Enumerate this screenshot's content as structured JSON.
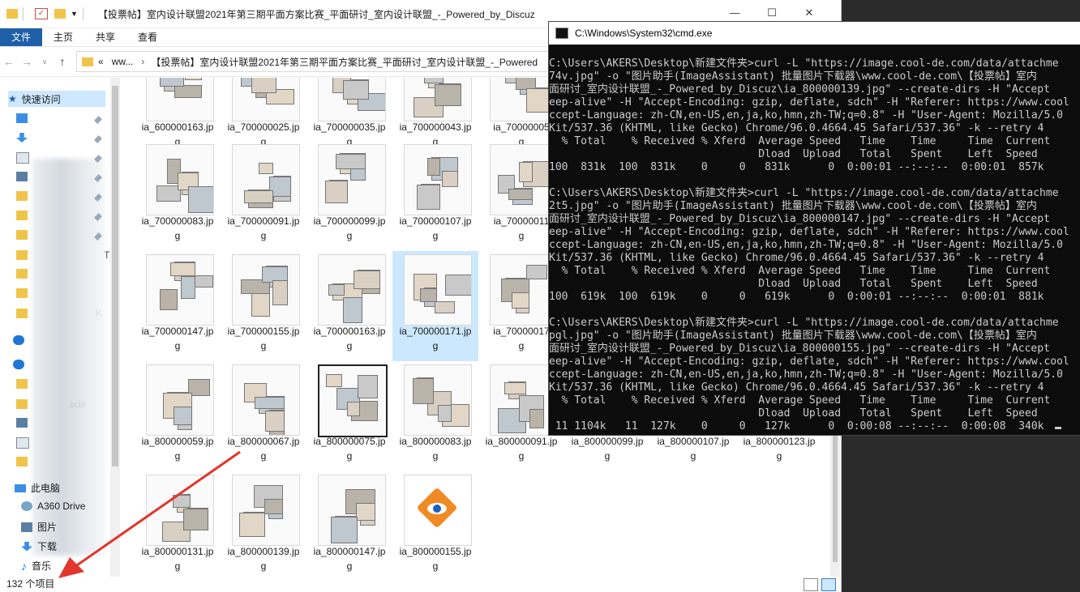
{
  "explorer": {
    "title": "【投票帖】室内设计联盟2021年第三期平面方案比赛_平面研讨_室内设计联盟_-_Powered_by_Discuz",
    "ribbon_tabs": [
      "文件",
      "主页",
      "共享",
      "查看"
    ],
    "address": {
      "prefix": "«",
      "crumb1": "ww...",
      "crumb2": "【投票帖】室内设计联盟2021年第三期平面方案比赛_平面研讨_室内设计联盟_-_Powered"
    },
    "nav": {
      "quick_access": "快速访问",
      "this_pc": "此电脑",
      "a360": "A360 Drive",
      "pictures": "图片",
      "downloads": "下载",
      "music": "音乐",
      "partial_downloads": "ads",
      "partial_t3": "T3",
      "partial_k": "K"
    },
    "files": [
      {
        "l1": "ia_600000163.jp",
        "l2": "g"
      },
      {
        "l1": "ia_700000025.jp",
        "l2": "g"
      },
      {
        "l1": "ia_700000035.jp",
        "l2": "g"
      },
      {
        "l1": "ia_700000043.jp",
        "l2": "g"
      },
      {
        "l1": "ia_70000005",
        "l2": "g"
      },
      {
        "l1": "ia_700000083.jp",
        "l2": "g"
      },
      {
        "l1": "ia_700000091.jp",
        "l2": "g"
      },
      {
        "l1": "ia_700000099.jp",
        "l2": "g"
      },
      {
        "l1": "ia_700000107.jp",
        "l2": "g"
      },
      {
        "l1": "ia_70000011",
        "l2": "g"
      },
      {
        "l1": "ia_700000147.jp",
        "l2": "g"
      },
      {
        "l1": "ia_700000155.jp",
        "l2": "g"
      },
      {
        "l1": "ia_700000163.jp",
        "l2": "g"
      },
      {
        "l1": "ia_700000171.jp",
        "l2": "g"
      },
      {
        "l1": "ia_70000017",
        "l2": "g"
      },
      {
        "l1": "ia_800000059.jp",
        "l2": "g"
      },
      {
        "l1": "ia_800000067.jp",
        "l2": "g"
      },
      {
        "l1": "ia_800000075.jp",
        "l2": "g"
      },
      {
        "l1": "ia_800000083.jp",
        "l2": "g"
      },
      {
        "l1": "ia_800000091.jp",
        "l2": "g"
      },
      {
        "l1": "ia_800000099.jp",
        "l2": "g"
      },
      {
        "l1": "ia_800000107.jp",
        "l2": "g"
      },
      {
        "l1": "ia_800000123.jp",
        "l2": "g"
      },
      {
        "l1": "ia_800000131.jp",
        "l2": "g"
      },
      {
        "l1": "ia_800000139.jp",
        "l2": "g"
      },
      {
        "l1": "ia_800000147.jp",
        "l2": "g"
      },
      {
        "l1": "ia_800000155.jp",
        "l2": "g"
      }
    ],
    "status_count": "132 个项目",
    "window_controls": [
      "—",
      "☐",
      "✕"
    ]
  },
  "cmd": {
    "title": "C:\\Windows\\System32\\cmd.exe",
    "lines": [
      "C:\\Users\\AKERS\\Desktop\\新建文件夹>curl -L \"https://image.cool-de.com/data/attachme",
      "74v.jpg\" -o \"图片助手(ImageAssistant) 批量图片下载器\\www.cool-de.com\\【投票帖】室内",
      "面研讨_室内设计联盟_-_Powered_by_Discuz\\ia_800000139.jpg\" --create-dirs -H \"Accept",
      "eep-alive\" -H \"Accept-Encoding: gzip, deflate, sdch\" -H \"Referer: https://www.cool",
      "ccept-Language: zh-CN,en-US,en,ja,ko,hmn,zh-TW;q=0.8\" -H \"User-Agent: Mozilla/5.0",
      "Kit/537.36 (KHTML, like Gecko) Chrome/96.0.4664.45 Safari/537.36\" -k --retry 4",
      "  % Total    % Received % Xferd  Average Speed   Time    Time     Time  Current",
      "                                 Dload  Upload   Total   Spent    Left  Speed",
      "100  831k  100  831k    0     0   831k      0  0:00:01 --:--:--  0:00:01  857k",
      "",
      "C:\\Users\\AKERS\\Desktop\\新建文件夹>curl -L \"https://image.cool-de.com/data/attachme",
      "2t5.jpg\" -o \"图片助手(ImageAssistant) 批量图片下载器\\www.cool-de.com\\【投票帖】室内",
      "面研讨_室内设计联盟_-_Powered_by_Discuz\\ia_800000147.jpg\" --create-dirs -H \"Accept",
      "eep-alive\" -H \"Accept-Encoding: gzip, deflate, sdch\" -H \"Referer: https://www.cool",
      "ccept-Language: zh-CN,en-US,en,ja,ko,hmn,zh-TW;q=0.8\" -H \"User-Agent: Mozilla/5.0",
      "Kit/537.36 (KHTML, like Gecko) Chrome/96.0.4664.45 Safari/537.36\" -k --retry 4",
      "  % Total    % Received % Xferd  Average Speed   Time    Time     Time  Current",
      "                                 Dload  Upload   Total   Spent    Left  Speed",
      "100  619k  100  619k    0     0   619k      0  0:00:01 --:--:--  0:00:01  881k",
      "",
      "C:\\Users\\AKERS\\Desktop\\新建文件夹>curl -L \"https://image.cool-de.com/data/attachme",
      "pgl.jpg\" -o \"图片助手(ImageAssistant) 批量图片下载器\\www.cool-de.com\\【投票帖】室内",
      "面研讨_室内设计联盟_-_Powered_by_Discuz\\ia_800000155.jpg\" --create-dirs -H \"Accept",
      "eep-alive\" -H \"Accept-Encoding: gzip, deflate, sdch\" -H \"Referer: https://www.cool",
      "ccept-Language: zh-CN,en-US,en,ja,ko,hmn,zh-TW;q=0.8\" -H \"User-Agent: Mozilla/5.0",
      "Kit/537.36 (KHTML, like Gecko) Chrome/96.0.4664.45 Safari/537.36\" -k --retry 4",
      "  % Total    % Received % Xferd  Average Speed   Time    Time     Time  Current",
      "                                 Dload  Upload   Total   Spent    Left  Speed",
      " 11 1104k   11  127k    0     0   127k      0  0:00:08 --:--:--  0:00:08  340k"
    ]
  },
  "colors": {
    "accent": "#1f5fa8",
    "selection": "#cce8ff",
    "cmd_bg": "#0c0c0c",
    "arrow": "#e0362b"
  }
}
